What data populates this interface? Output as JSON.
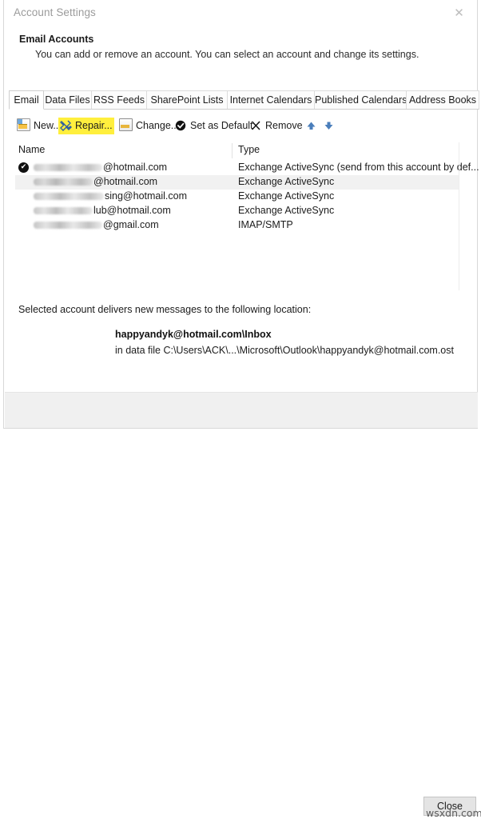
{
  "window": {
    "title": "Account Settings",
    "close_icon": "close-x-icon",
    "close_glyph": "✕"
  },
  "header": {
    "title": "Email Accounts",
    "description": "You can add or remove an account. You can select an account and change its settings."
  },
  "tabs": [
    {
      "label": "Email",
      "active": true
    },
    {
      "label": "Data Files",
      "active": false
    },
    {
      "label": "RSS Feeds",
      "active": false
    },
    {
      "label": "SharePoint Lists",
      "active": false
    },
    {
      "label": "Internet Calendars",
      "active": false
    },
    {
      "label": "Published Calendars",
      "active": false
    },
    {
      "label": "Address Books",
      "active": false
    }
  ],
  "toolbar": {
    "buttons": [
      {
        "label": "New...",
        "icon": "new-mail-icon",
        "highlighted": false
      },
      {
        "label": "Repair...",
        "icon": "repair-tools-icon",
        "highlighted": true
      },
      {
        "label": "Change...",
        "icon": "change-account-icon",
        "highlighted": false
      },
      {
        "label": "Set as Default",
        "icon": "check-circle-icon",
        "highlighted": false
      },
      {
        "label": "Remove",
        "icon": "x-remove-icon",
        "highlighted": false
      }
    ],
    "move_up_icon": "arrow-up-icon",
    "move_down_icon": "arrow-down-icon",
    "arrow_color": "#4a7ebb",
    "highlight_color": "#ffef3d"
  },
  "list": {
    "columns": [
      "Name",
      "Type"
    ],
    "rows": [
      {
        "name_redacted": true,
        "name_suffix": "@hotmail.com",
        "type": "Exchange ActiveSync (send from this account by def...",
        "is_default": true,
        "selected": false
      },
      {
        "name_redacted": true,
        "name_suffix": "@hotmail.com",
        "type": "Exchange ActiveSync",
        "is_default": false,
        "selected": true
      },
      {
        "name_redacted": true,
        "name_suffix": "sing@hotmail.com",
        "type": "Exchange ActiveSync",
        "is_default": false,
        "selected": false
      },
      {
        "name_redacted": true,
        "name_suffix": "lub@hotmail.com",
        "type": "Exchange ActiveSync",
        "is_default": false,
        "selected": false
      },
      {
        "name_redacted": true,
        "name_suffix": "@gmail.com",
        "type": "IMAP/SMTP",
        "is_default": false,
        "selected": false
      }
    ],
    "default_mark_glyph": "✔",
    "selection_color": "#f1f1f1"
  },
  "delivery": {
    "label": "Selected account delivers new messages to the following location:",
    "location": "happyandyk@hotmail.com\\Inbox",
    "data_file": "in data file C:\\Users\\ACK\\...\\Microsoft\\Outlook\\happyandyk@hotmail.com.ost"
  },
  "footer": {
    "close_label": "Close",
    "watermark": "wsxdn.com"
  }
}
